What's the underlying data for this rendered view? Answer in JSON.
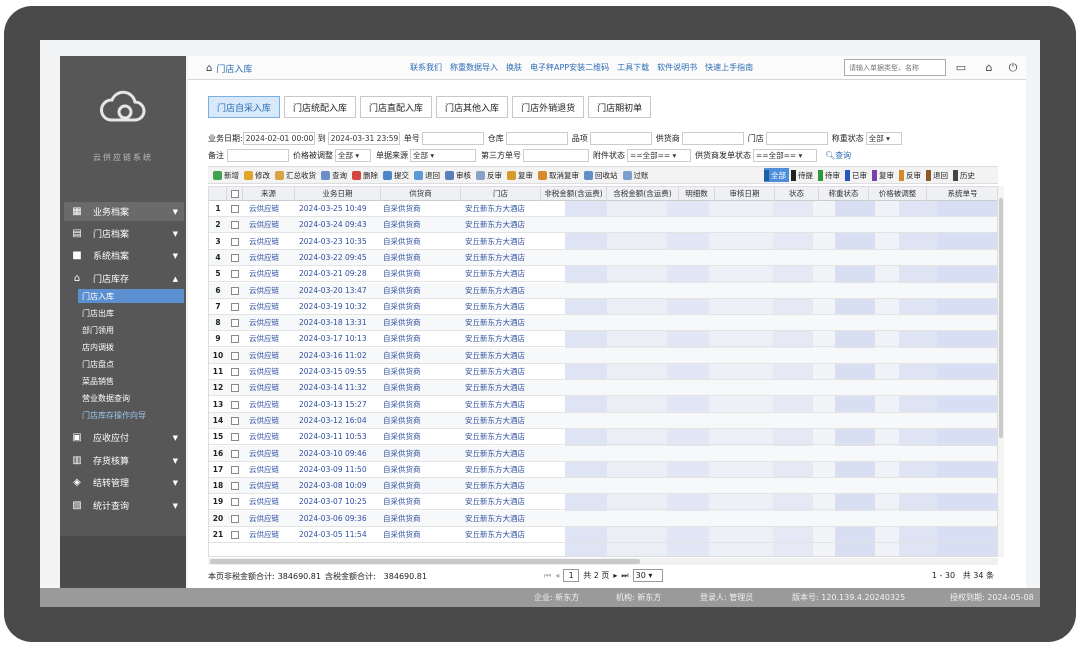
{
  "sidebar": {
    "system_name": "云供应链系统",
    "items": [
      {
        "label": "业务档案",
        "icon": "grid-icon"
      },
      {
        "label": "门店档案",
        "icon": "store-icon"
      },
      {
        "label": "系统档案",
        "icon": "truck-icon"
      },
      {
        "label": "门店库存",
        "icon": "house-icon"
      },
      {
        "label": "应收应付",
        "icon": "clipboard-icon"
      },
      {
        "label": "存货核算",
        "icon": "cart-icon"
      },
      {
        "label": "结转管理",
        "icon": "layers-icon"
      },
      {
        "label": "统计查询",
        "icon": "chart-icon"
      }
    ],
    "subitems": [
      "门店入库",
      "门店出库",
      "部门领用",
      "店内调拨",
      "门店盘点",
      "菜品销售",
      "营业数据查询",
      "门店库存操作向导"
    ]
  },
  "topbar": {
    "page_title": "门店入库",
    "links": [
      "联系我们",
      "称重数据导入",
      "换肤",
      "电子秤APP安装二维码",
      "工具下载",
      "软件说明书",
      "快速上手指南"
    ],
    "search_placeholder": "请输入单据类型、名称"
  },
  "tabs": [
    "门店自采入库",
    "门店统配入库",
    "门店直配入库",
    "门店其他入库",
    "门店外销退货",
    "门店期初单"
  ],
  "filters": {
    "date_label": "业务日期:",
    "date_from": "2024-02-01 00:00",
    "to_label": "到",
    "date_to": "2024-03-31 23:59",
    "order_no_label": "单号",
    "warehouse_label": "仓库",
    "item_label": "品项",
    "supplier_label": "供货商",
    "store_label": "门店",
    "weigh_status_label": "称重状态",
    "weigh_status_value": "全部",
    "remark_label": "备注",
    "price_adjusted_label": "价格被调整",
    "price_adjusted_value": "全部",
    "source_label": "单据来源",
    "source_value": "全部",
    "third_party_label": "第三方单号",
    "attachment_label": "附件状态",
    "attachment_value": "==全部==",
    "supplier_send_label": "供货商发单状态",
    "supplier_send_value": "==全部==",
    "query_label": "查询"
  },
  "toolbar": {
    "buttons": [
      "新增",
      "修改",
      "汇总收货",
      "查询",
      "删除",
      "提交",
      "退回",
      "审核",
      "反审",
      "复审",
      "取消复审",
      "回收站",
      "过账"
    ],
    "status_filters": [
      "全部",
      "待提",
      "待审",
      "已审",
      "复审",
      "反审",
      "退回",
      "历史"
    ]
  },
  "colors": {
    "accent": "#2e6cb5",
    "selected_tab": "#d7e9fa",
    "sidebar": "#575757"
  },
  "grid": {
    "headers": [
      "来源",
      "业务日期",
      "供货商",
      "门店",
      "非税金额(含运费)",
      "含税金额(含运费)",
      "明细数",
      "审核日期",
      "状态",
      "称重状态",
      "价格被调整",
      "系统单号"
    ],
    "rows": [
      {
        "n": "1",
        "source": "云供应链",
        "date": "2024-03-25 10:49",
        "supplier": "自采供货商",
        "store": "安丘新东方大酒店"
      },
      {
        "n": "2",
        "source": "云供应链",
        "date": "2024-03-24 09:43",
        "supplier": "自采供货商",
        "store": "安丘新东方大酒店"
      },
      {
        "n": "3",
        "source": "云供应链",
        "date": "2024-03-23 10:35",
        "supplier": "自采供货商",
        "store": "安丘新东方大酒店"
      },
      {
        "n": "4",
        "source": "云供应链",
        "date": "2024-03-22 09:45",
        "supplier": "自采供货商",
        "store": "安丘新东方大酒店"
      },
      {
        "n": "5",
        "source": "云供应链",
        "date": "2024-03-21 09:28",
        "supplier": "自采供货商",
        "store": "安丘新东方大酒店"
      },
      {
        "n": "6",
        "source": "云供应链",
        "date": "2024-03-20 13:47",
        "supplier": "自采供货商",
        "store": "安丘新东方大酒店"
      },
      {
        "n": "7",
        "source": "云供应链",
        "date": "2024-03-19 10:32",
        "supplier": "自采供货商",
        "store": "安丘新东方大酒店"
      },
      {
        "n": "8",
        "source": "云供应链",
        "date": "2024-03-18 13:31",
        "supplier": "自采供货商",
        "store": "安丘新东方大酒店"
      },
      {
        "n": "9",
        "source": "云供应链",
        "date": "2024-03-17 10:13",
        "supplier": "自采供货商",
        "store": "安丘新东方大酒店"
      },
      {
        "n": "10",
        "source": "云供应链",
        "date": "2024-03-16 11:02",
        "supplier": "自采供货商",
        "store": "安丘新东方大酒店"
      },
      {
        "n": "11",
        "source": "云供应链",
        "date": "2024-03-15 09:55",
        "supplier": "自采供货商",
        "store": "安丘新东方大酒店"
      },
      {
        "n": "12",
        "source": "云供应链",
        "date": "2024-03-14 11:32",
        "supplier": "自采供货商",
        "store": "安丘新东方大酒店"
      },
      {
        "n": "13",
        "source": "云供应链",
        "date": "2024-03-13 15:27",
        "supplier": "自采供货商",
        "store": "安丘新东方大酒店"
      },
      {
        "n": "14",
        "source": "云供应链",
        "date": "2024-03-12 16:04",
        "supplier": "自采供货商",
        "store": "安丘新东方大酒店"
      },
      {
        "n": "15",
        "source": "云供应链",
        "date": "2024-03-11 10:53",
        "supplier": "自采供货商",
        "store": "安丘新东方大酒店"
      },
      {
        "n": "16",
        "source": "云供应链",
        "date": "2024-03-10 09:46",
        "supplier": "自采供货商",
        "store": "安丘新东方大酒店"
      },
      {
        "n": "17",
        "source": "云供应链",
        "date": "2024-03-09 11:50",
        "supplier": "自采供货商",
        "store": "安丘新东方大酒店"
      },
      {
        "n": "18",
        "source": "云供应链",
        "date": "2024-03-08 10:09",
        "supplier": "自采供货商",
        "store": "安丘新东方大酒店"
      },
      {
        "n": "19",
        "source": "云供应链",
        "date": "2024-03-07 10:25",
        "supplier": "自采供货商",
        "store": "安丘新东方大酒店"
      },
      {
        "n": "20",
        "source": "云供应链",
        "date": "2024-03-06 09:36",
        "supplier": "自采供货商",
        "store": "安丘新东方大酒店"
      },
      {
        "n": "21",
        "source": "云供应链",
        "date": "2024-03-05 11:54",
        "supplier": "自采供货商",
        "store": "安丘新东方大酒店"
      }
    ]
  },
  "footer": {
    "non_tax_label": "本页非税金额合计:",
    "non_tax_value": "384690.81",
    "tax_label": "含税金额合计:",
    "tax_value": "384690.81",
    "page_value": "1",
    "total_pages": "共 2 页",
    "page_size": "30",
    "range": "1 - 30",
    "total": "共 34 条"
  },
  "statusbar": {
    "company": "企业: 新东方",
    "org": "机构: 新东方",
    "user": "登录人: 管理员",
    "version": "版本号: 120.139.4.20240325",
    "license": "授权到期: 2024-05-08"
  }
}
